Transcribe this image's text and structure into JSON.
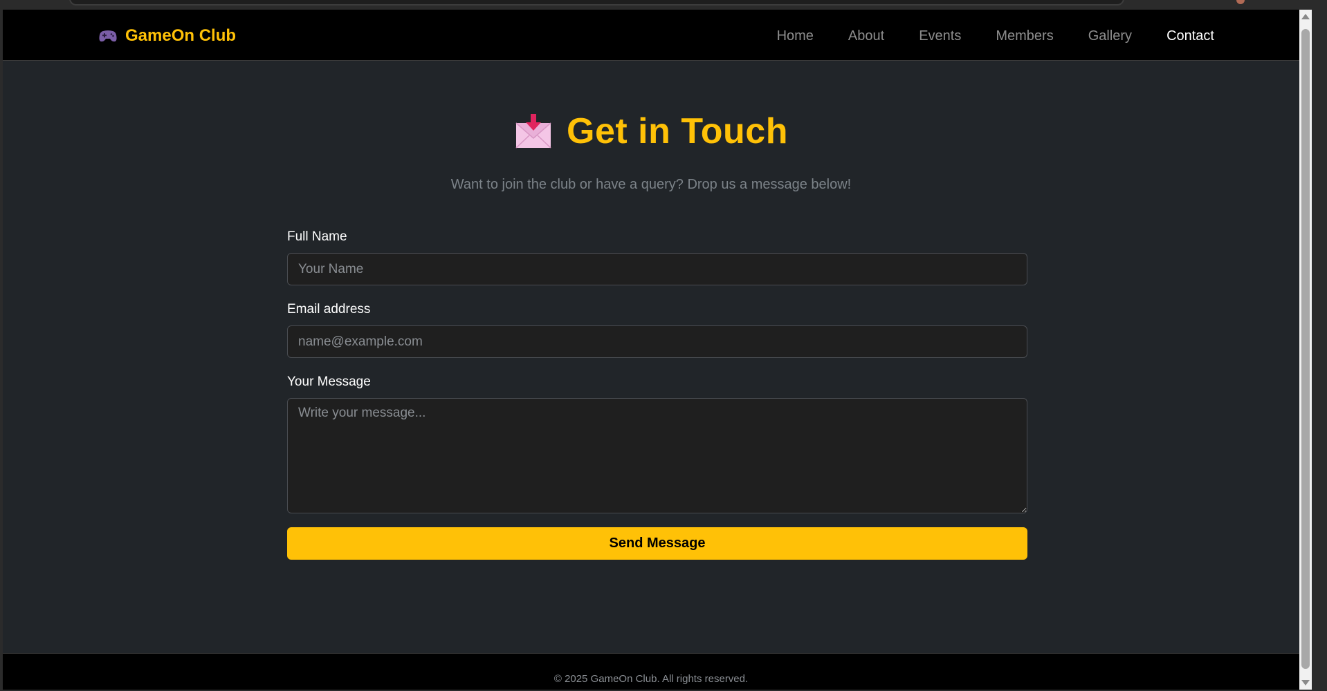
{
  "navbar": {
    "brand": "GameOn Club",
    "brand_icon": "game-controller-icon",
    "links": [
      {
        "label": "Home",
        "active": false
      },
      {
        "label": "About",
        "active": false
      },
      {
        "label": "Events",
        "active": false
      },
      {
        "label": "Members",
        "active": false
      },
      {
        "label": "Gallery",
        "active": false
      },
      {
        "label": "Contact",
        "active": true
      }
    ]
  },
  "hero": {
    "icon": "envelope-with-arrow-icon",
    "title": "Get in Touch",
    "subtitle": "Want to join the club or have a query? Drop us a message below!"
  },
  "form": {
    "name": {
      "label": "Full Name",
      "placeholder": "Your Name",
      "value": ""
    },
    "email": {
      "label": "Email address",
      "placeholder": "name@example.com",
      "value": ""
    },
    "message": {
      "label": "Your Message",
      "placeholder": "Write your message...",
      "value": ""
    },
    "submit_label": "Send Message"
  },
  "footer": {
    "text": "© 2025 GameOn Club. All rights reserved."
  },
  "colors": {
    "accent": "#ffc107",
    "page_bg": "#212529",
    "navbar_bg": "#000000",
    "input_bg": "#1f1f1f"
  }
}
